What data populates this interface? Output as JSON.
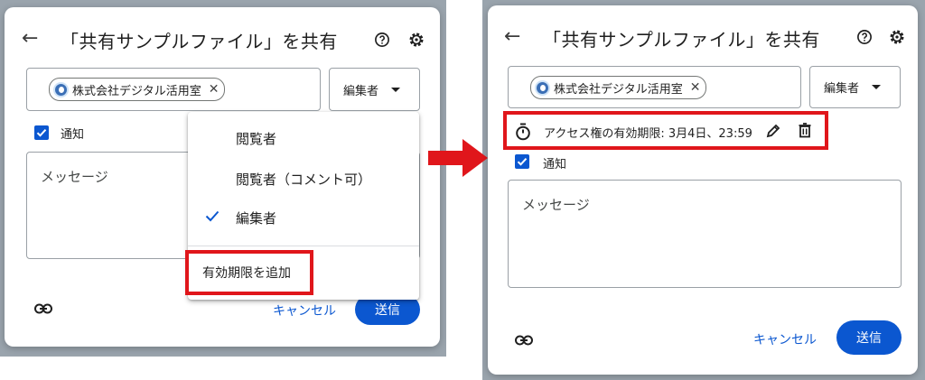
{
  "colors": {
    "accent": "#0b57d0",
    "highlight": "#e0161b",
    "backdrop": "#9aa4ad"
  },
  "before": {
    "title": "「共有サンプルファイル」を共有",
    "chip_label": "株式会社デジタル活用室",
    "role_label": "編集者",
    "notify_label": "通知",
    "message_placeholder": "メッセージ",
    "cancel_label": "キャンセル",
    "send_label": "送信",
    "menu": {
      "items": [
        "閲覧者",
        "閲覧者（コメント可）",
        "編集者"
      ],
      "selected": "編集者",
      "add_expiry_label": "有効期限を追加"
    }
  },
  "after": {
    "title": "「共有サンプルファイル」を共有",
    "chip_label": "株式会社デジタル活用室",
    "role_label": "編集者",
    "expiry_text": "アクセス権の有効期限: 3月4日、23:59",
    "notify_label": "通知",
    "message_placeholder": "メッセージ",
    "cancel_label": "キャンセル",
    "send_label": "送信"
  },
  "icons": [
    "back-arrow-icon",
    "help-icon",
    "settings-gear-icon",
    "close-icon",
    "dropdown-caret-icon",
    "check-icon",
    "link-icon",
    "timer-icon",
    "edit-pencil-icon",
    "trash-icon",
    "right-arrow-icon"
  ]
}
